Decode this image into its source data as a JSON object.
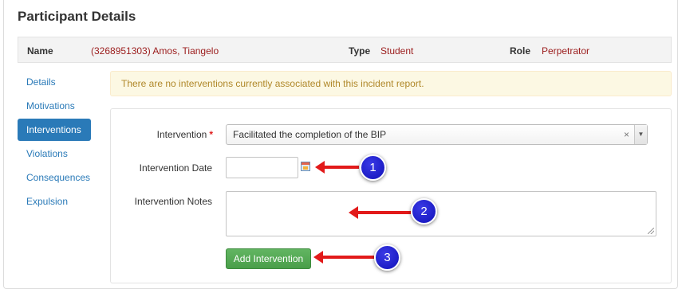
{
  "page": {
    "title": "Participant Details"
  },
  "summary": {
    "name_label": "Name",
    "name_value": "(3268951303) Amos, Tiangelo",
    "type_label": "Type",
    "type_value": "Student",
    "role_label": "Role",
    "role_value": "Perpetrator"
  },
  "nav": {
    "items": [
      {
        "label": "Details"
      },
      {
        "label": "Motivations"
      },
      {
        "label": "Interventions",
        "active": true
      },
      {
        "label": "Violations"
      },
      {
        "label": "Consequences"
      },
      {
        "label": "Expulsion"
      }
    ]
  },
  "alert": {
    "text": "There are no interventions currently associated with this incident report."
  },
  "form": {
    "intervention_label": "Intervention",
    "required_mark": "*",
    "intervention_value": "Facilitated the completion of the BIP",
    "clear_glyph": "×",
    "dropdown_glyph": "▼",
    "date_label": "Intervention Date",
    "date_value": "",
    "notes_label": "Intervention Notes",
    "notes_value": "",
    "submit_label": "Add Intervention"
  },
  "annotations": {
    "badges": [
      "1",
      "2",
      "3"
    ],
    "color": "#e21a1a",
    "badge_color": "#1a1ad0"
  },
  "icons": {
    "calendar": "calendar-icon",
    "clear": "clear-icon",
    "dropdown": "chevron-down-icon"
  }
}
